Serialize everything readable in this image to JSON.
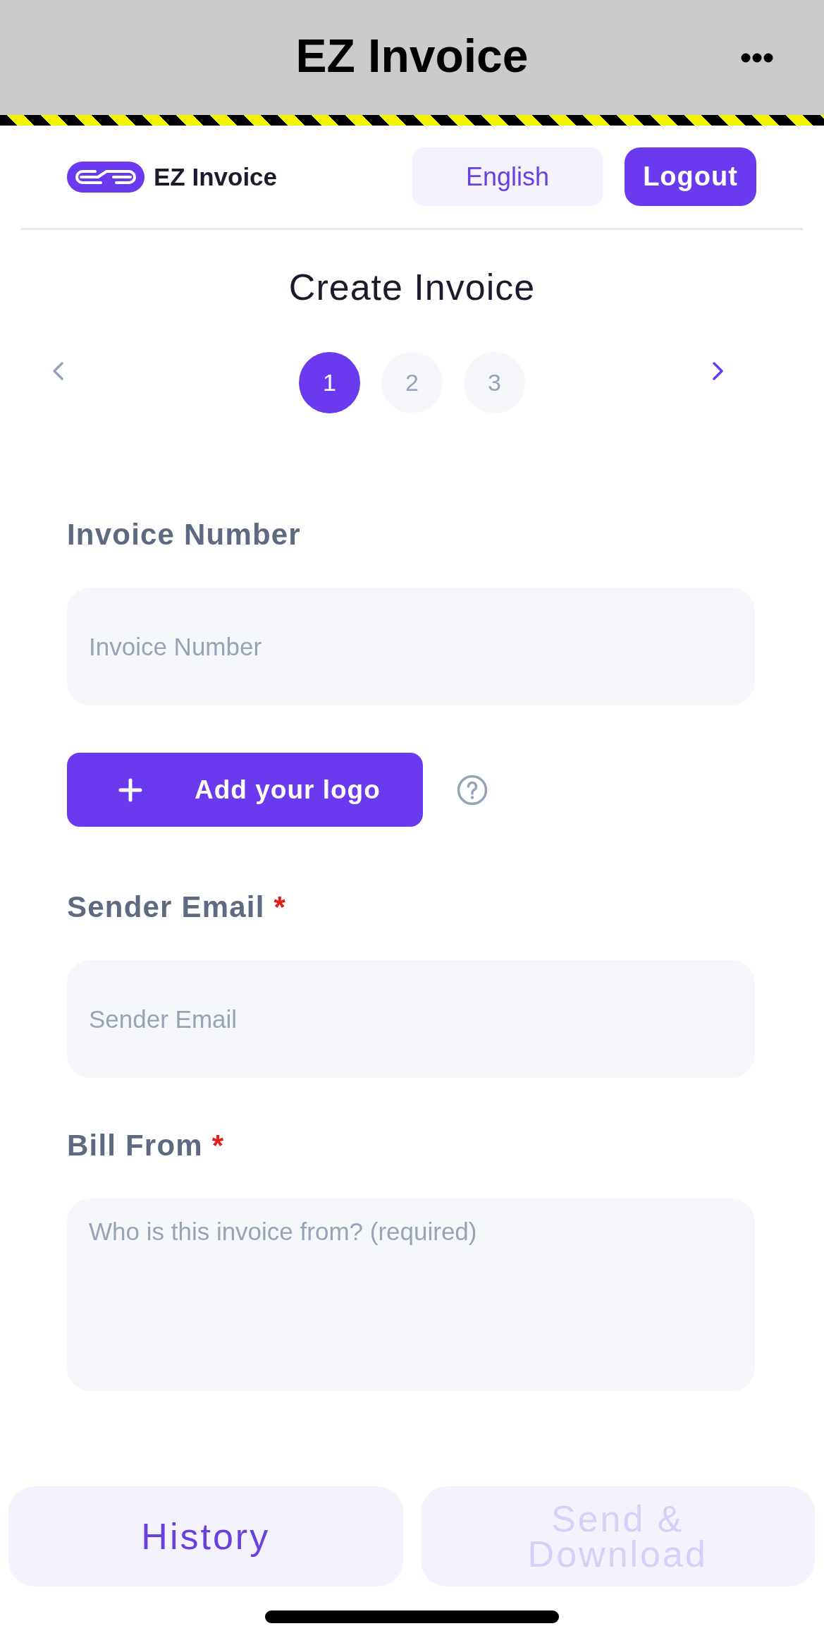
{
  "title_bar": {
    "title": "EZ Invoice"
  },
  "header": {
    "brand": "EZ Invoice",
    "language_button": "English",
    "logout_button": "Logout"
  },
  "page_title": "Create Invoice",
  "stepper": {
    "previous": {
      "disabled": true
    },
    "next": {
      "disabled": false
    },
    "steps": [
      {
        "label": "1",
        "selected": true
      },
      {
        "label": "2",
        "selected": false
      },
      {
        "label": "3",
        "selected": false
      }
    ]
  },
  "form": {
    "items": [
      {
        "kind": "input",
        "label": "Invoice Number",
        "placeholder": "Invoice Number"
      },
      {
        "kind": "logo_button",
        "label": "Add your logo"
      },
      {
        "kind": "input",
        "label": "Sender Email",
        "required_mark": "*",
        "placeholder": "Sender Email"
      },
      {
        "kind": "textarea",
        "label": "Bill From",
        "required_mark": "*",
        "placeholder": "Who is this invoice from? (required)"
      }
    ]
  },
  "bottom_bar": {
    "buttons": [
      {
        "label": "History",
        "disabled": false
      },
      {
        "label": "Send & Download",
        "disabled": true
      }
    ]
  }
}
